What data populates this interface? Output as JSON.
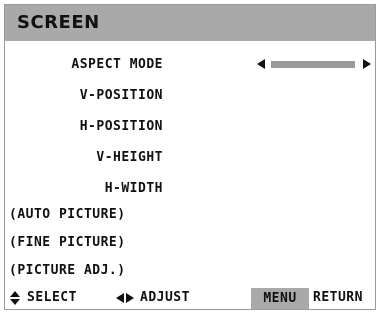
{
  "header": {
    "title": "SCREEN"
  },
  "menu": {
    "items": [
      {
        "label": "ASPECT MODE"
      },
      {
        "label": "V-POSITION"
      },
      {
        "label": "H-POSITION"
      },
      {
        "label": "V-HEIGHT"
      },
      {
        "label": "H-WIDTH"
      },
      {
        "label": "(AUTO PICTURE)"
      },
      {
        "label": "(FINE PICTURE)"
      },
      {
        "label": "(PICTURE ADJ.)"
      }
    ],
    "aspect_slider": {
      "left_icon": "left-arrow-icon",
      "right_icon": "right-arrow-icon"
    }
  },
  "footer": {
    "select_label": "SELECT",
    "adjust_label": "ADJUST",
    "menu_key": "MENU",
    "return_label": "RETURN",
    "select_icon": "up-down-arrows-icon",
    "adjust_icon": "left-right-arrows-icon"
  },
  "colors": {
    "header_bg": "#a9a9a9",
    "slider_track": "#9b9b9b",
    "text": "#111111"
  }
}
